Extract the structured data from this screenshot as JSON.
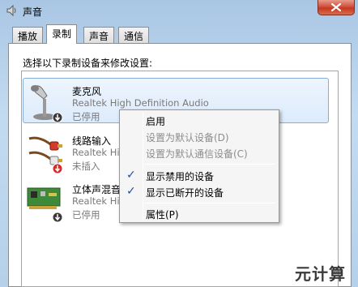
{
  "window": {
    "title": "声音",
    "close_icon": "close-x-icon"
  },
  "tabs": [
    {
      "label": "播放",
      "active": false
    },
    {
      "label": "录制",
      "active": true
    },
    {
      "label": "声音",
      "active": false
    },
    {
      "label": "通信",
      "active": false
    }
  ],
  "instruction": "选择以下录制设备来修改设置:",
  "devices": [
    {
      "name": "麦克风",
      "description": "Realtek High Definition Audio",
      "status": "已停用",
      "icon": "microphone-icon",
      "selected": true
    },
    {
      "name": "线路输入",
      "description": "Realtek Hig",
      "status": "未插入",
      "icon": "line-in-cable-icon",
      "selected": false
    },
    {
      "name": "立体声混音",
      "description": "Realtek Hig",
      "status": "已停用",
      "icon": "sound-card-icon",
      "selected": false
    }
  ],
  "context_menu": {
    "items": [
      {
        "label": "启用",
        "disabled": false,
        "checked": false
      },
      {
        "label": "设置为默认设备(D)",
        "disabled": true,
        "checked": false
      },
      {
        "label": "设置为默认通信设备(C)",
        "disabled": true,
        "checked": false
      },
      {
        "label": "显示禁用的设备",
        "disabled": false,
        "checked": true
      },
      {
        "label": "显示已断开的设备",
        "disabled": false,
        "checked": true
      },
      {
        "label": "属性(P)",
        "disabled": false,
        "checked": false
      }
    ],
    "check_glyph": "✓"
  },
  "watermark": "元计算",
  "colors": {
    "selection_fill": "#dcebfc",
    "selection_border": "#84acdd",
    "disabled_text": "#8d8d8d",
    "check": "#1c4fa8"
  }
}
